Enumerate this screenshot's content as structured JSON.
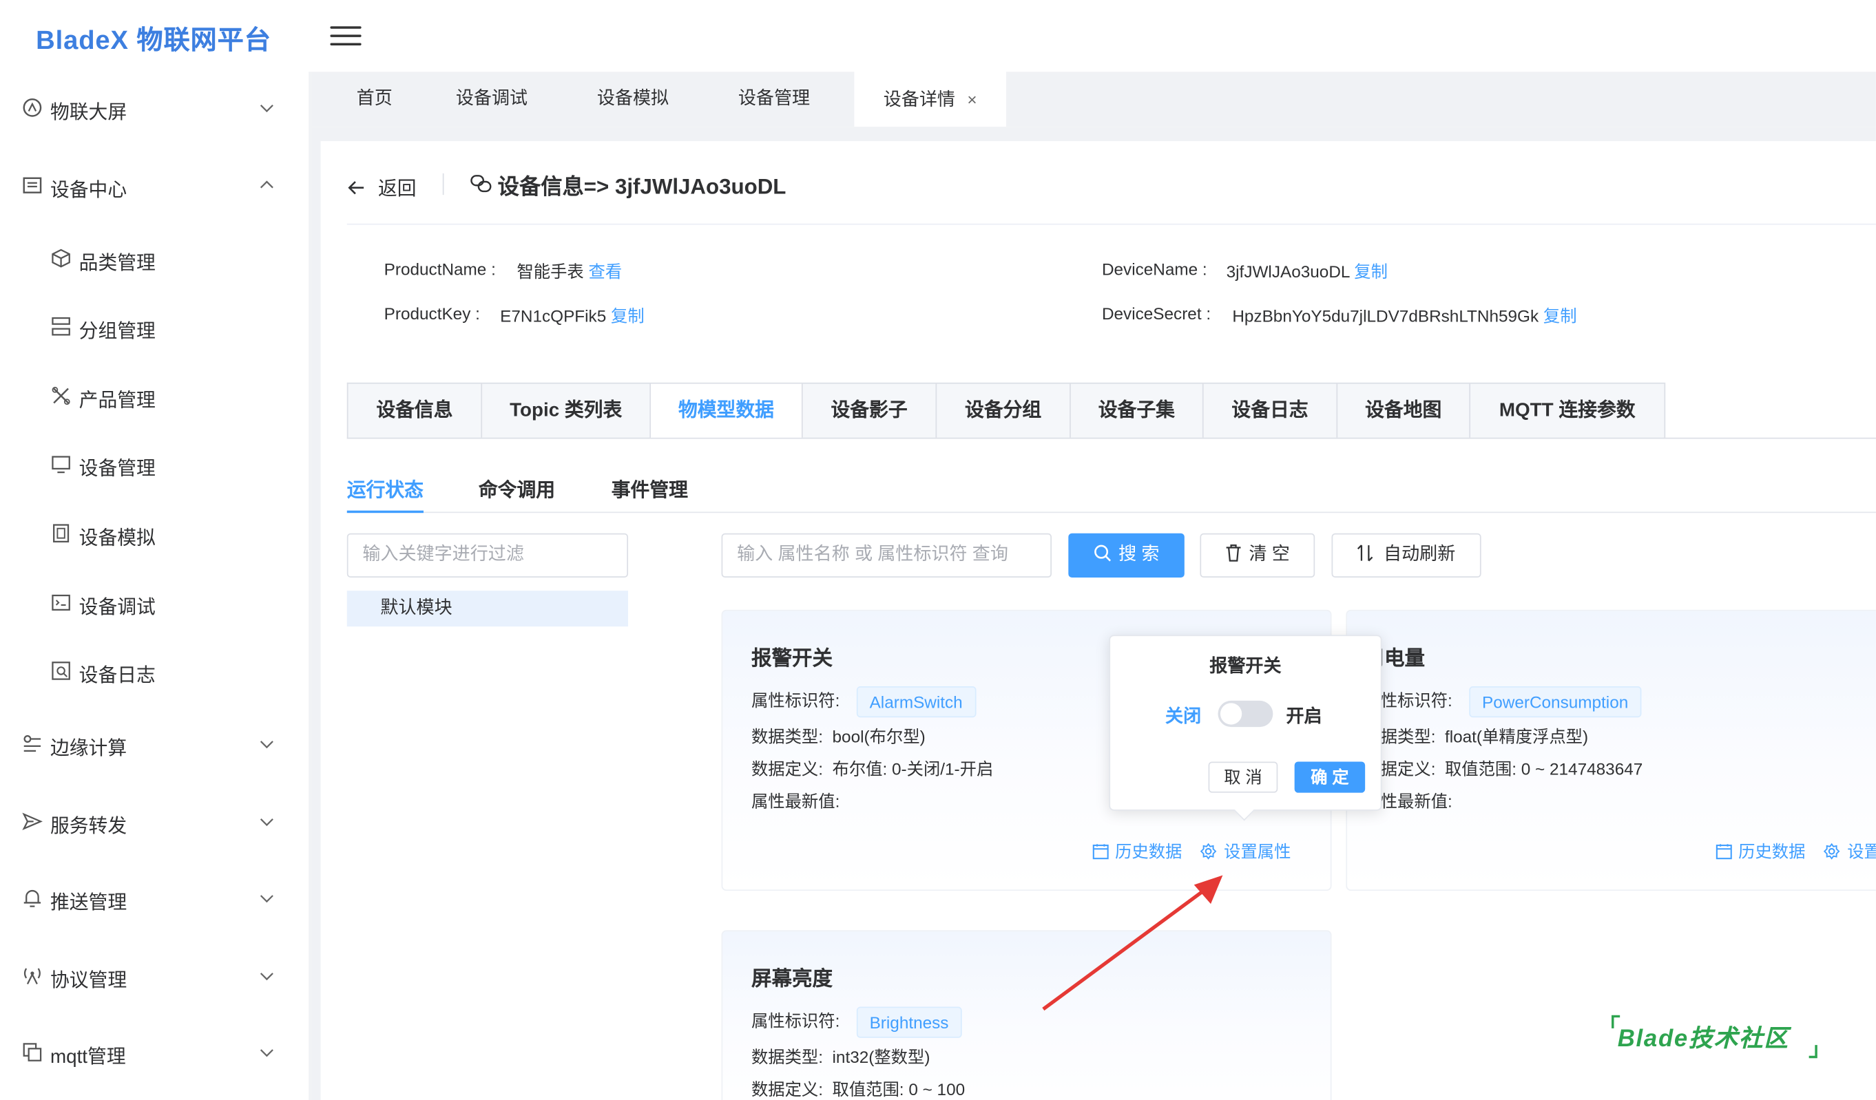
{
  "header": {
    "logo": "BladeX 物联网平台",
    "menu_icon": "hamburger-icon"
  },
  "sidebar": {
    "groups": [
      {
        "label": "物联大屏",
        "icon": "dashboard-icon",
        "expanded": false
      },
      {
        "label": "设备中心",
        "icon": "device-center-icon",
        "expanded": true
      },
      {
        "label": "边缘计算",
        "icon": "edge-compute-icon",
        "expanded": false
      },
      {
        "label": "服务转发",
        "icon": "send-icon",
        "expanded": false
      },
      {
        "label": "推送管理",
        "icon": "bell-icon",
        "expanded": false
      },
      {
        "label": "协议管理",
        "icon": "antenna-icon",
        "expanded": false
      },
      {
        "label": "mqtt管理",
        "icon": "copy-icon",
        "expanded": false
      }
    ],
    "sub_items": [
      {
        "label": "品类管理",
        "icon": "cube-icon"
      },
      {
        "label": "分组管理",
        "icon": "group-icon"
      },
      {
        "label": "产品管理",
        "icon": "tools-icon"
      },
      {
        "label": "设备管理",
        "icon": "monitor-icon"
      },
      {
        "label": "设备模拟",
        "icon": "simulate-icon"
      },
      {
        "label": "设备调试",
        "icon": "debug-icon"
      },
      {
        "label": "设备日志",
        "icon": "log-icon"
      }
    ]
  },
  "tabs": [
    {
      "label": "首页",
      "active": false
    },
    {
      "label": "设备调试",
      "active": false
    },
    {
      "label": "设备模拟",
      "active": false
    },
    {
      "label": "设备管理",
      "active": false
    },
    {
      "label": "设备详情",
      "active": true,
      "close": "×"
    }
  ],
  "page": {
    "back_label": "返回",
    "title": "设备信息=> 3jfJWlJAo3uoDL",
    "info": {
      "product_name_label": "ProductName :",
      "product_name_value": "智能手表",
      "product_name_link": "查看",
      "product_key_label": "ProductKey :",
      "product_key_value": "E7N1cQPFik5",
      "product_key_link": "复制",
      "device_name_label": "DeviceName :",
      "device_name_value": "3jfJWlJAo3uoDL",
      "device_name_link": "复制",
      "device_secret_label": "DeviceSecret :",
      "device_secret_value": "HpzBbnYoY5du7jlLDV7dBRshLTNh59Gk",
      "device_secret_link": "复制"
    },
    "main_tabs": [
      "设备信息",
      "Topic 类列表",
      "物模型数据",
      "设备影子",
      "设备分组",
      "设备子集",
      "设备日志",
      "设备地图",
      "MQTT 连接参数"
    ],
    "main_tab_active": "物模型数据",
    "sub_tabs": [
      "运行状态",
      "命令调用",
      "事件管理"
    ],
    "sub_tab_active": "运行状态",
    "filter_placeholder": "输入关键字进行过滤",
    "tree_items": [
      "默认模块"
    ],
    "search_placeholder": "输入 属性名称 或 属性标识符 查询",
    "search_button": "搜 索",
    "clear_button": "清 空",
    "refresh_button": "自动刷新"
  },
  "properties": [
    {
      "title": "报警开关",
      "id_label": "属性标识符:",
      "id": "AlarmSwitch",
      "type_label": "数据类型:",
      "type": "bool(布尔型)",
      "def_label": "数据定义:",
      "def": "布尔值: 0-关闭/1-开启",
      "latest_label": "属性最新值:",
      "history": "历史数据",
      "setting": "设置属性"
    },
    {
      "title": "用电量",
      "id_label": "属性标识符:",
      "id": "PowerConsumption",
      "type_label": "数据类型:",
      "type": "float(单精度浮点型)",
      "def_label": "数据定义:",
      "def": "取值范围: 0 ~ 2147483647",
      "latest_label": "属性最新值:",
      "history": "历史数据",
      "setting": "设置"
    },
    {
      "title": "屏幕亮度",
      "id_label": "属性标识符:",
      "id": "Brightness",
      "type_label": "数据类型:",
      "type": "int32(整数型)",
      "def_label": "数据定义:",
      "def": "取值范围: 0 ~ 100"
    }
  ],
  "popover": {
    "title": "报警开关",
    "off_label": "关闭",
    "on_label": "开启",
    "switch_on": false,
    "cancel": "取 消",
    "confirm": "确 定"
  },
  "watermark": "Blade技术社区",
  "colors": {
    "primary": "#409eff",
    "logo": "#3d7fe0",
    "annotation_arrow": "#e53935",
    "watermark": "#2ea44f"
  }
}
